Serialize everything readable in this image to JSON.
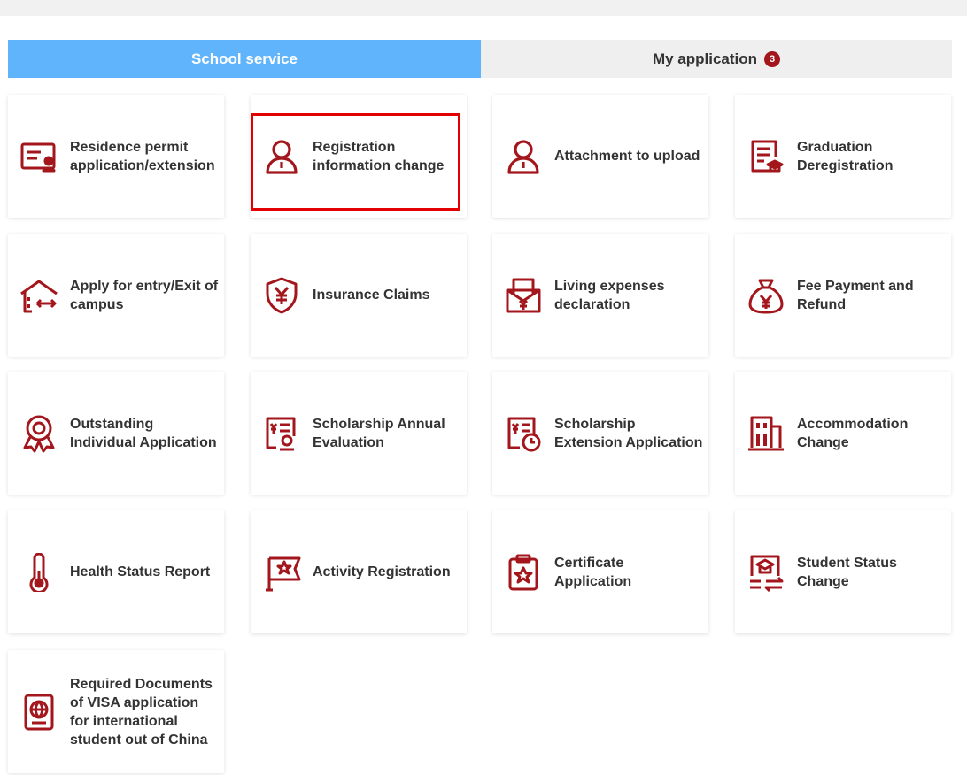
{
  "tabs": {
    "school_service": "School service",
    "my_application": "My application",
    "my_application_badge": "3"
  },
  "accent_color": "#a3161c",
  "tab_active_color": "#5fb4fb",
  "cards": [
    {
      "label": "Residence permit application/extension",
      "icon": "id-card-icon"
    },
    {
      "label": "Registration information change",
      "icon": "person-icon"
    },
    {
      "label": "Attachment to upload",
      "icon": "person-icon"
    },
    {
      "label": "Graduation Deregistration",
      "icon": "document-grad-cap-icon"
    },
    {
      "label": "Apply for entry/Exit of campus",
      "icon": "building-arrows-icon"
    },
    {
      "label": "Insurance Claims",
      "icon": "shield-yen-icon"
    },
    {
      "label": "Living expenses declaration",
      "icon": "envelope-yen-icon"
    },
    {
      "label": "Fee Payment and Refund",
      "icon": "money-bag-yen-icon"
    },
    {
      "label": "Outstanding Individual Application",
      "icon": "award-ribbon-icon"
    },
    {
      "label": "Scholarship Annual Evaluation",
      "icon": "document-award-icon"
    },
    {
      "label": "Scholarship Extension Application",
      "icon": "document-clock-icon"
    },
    {
      "label": "Accommodation Change",
      "icon": "dormitory-icon"
    },
    {
      "label": "Health Status Report",
      "icon": "thermometer-icon"
    },
    {
      "label": "Activity Registration",
      "icon": "flag-star-icon"
    },
    {
      "label": "Certificate Application",
      "icon": "clipboard-star-icon"
    },
    {
      "label": "Student Status Change",
      "icon": "document-swap-icon"
    },
    {
      "label": "Required Documents of VISA application for international student out of China",
      "icon": "passport-icon"
    }
  ]
}
